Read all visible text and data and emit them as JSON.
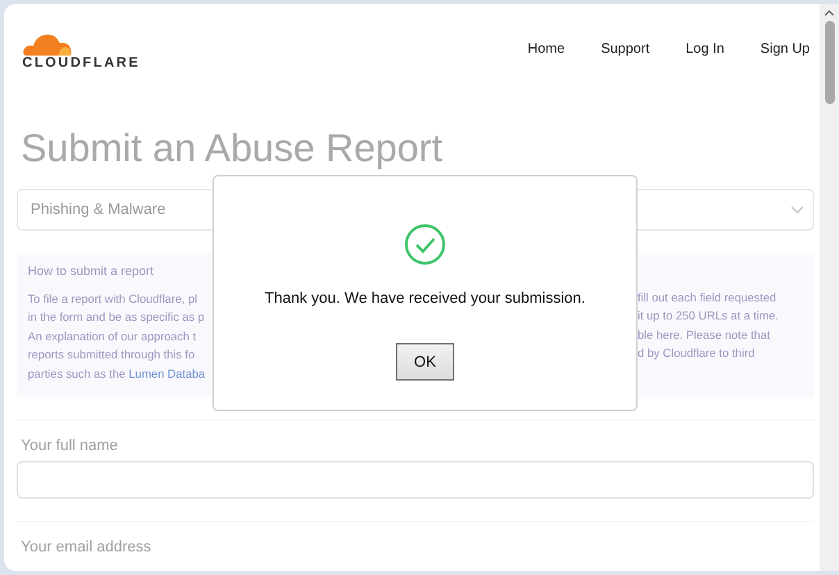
{
  "header": {
    "logo": "CLOUDFLARE",
    "nav": [
      "Home",
      "Support",
      "Log In",
      "Sign Up"
    ]
  },
  "page": {
    "title": "Submit an Abuse Report",
    "category_select": {
      "value": "Phishing & Malware"
    },
    "info": {
      "heading": "How to submit a report",
      "lines_left": [
        {
          "text": "To file a report with Cloudflare, pl"
        },
        {
          "text": "in the form and be as specific as p"
        },
        {
          "text": "An explanation of our approach t"
        },
        {
          "text": "reports submitted through this fo"
        },
        {
          "text": "parties such as the ",
          "link": "Lumen Databa"
        }
      ],
      "lines_right": [
        "fill out each field requested",
        "it up to 250 URLs at a time.",
        "ble here. Please note that",
        "d by Cloudflare to third"
      ]
    },
    "fields": [
      {
        "label": "Your full name",
        "kind": "input"
      },
      {
        "label": "Your email address",
        "kind": "label"
      }
    ]
  },
  "dialog": {
    "message": "Thank you. We have received your submission.",
    "buttons": [
      "OK"
    ]
  }
}
